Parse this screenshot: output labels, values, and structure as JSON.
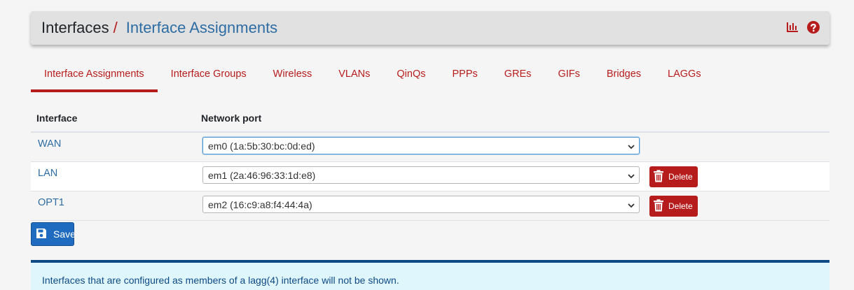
{
  "breadcrumb": {
    "root": "Interfaces",
    "separator": "/",
    "current": "Interface Assignments"
  },
  "header_icons": [
    "bar-chart-icon",
    "help-icon"
  ],
  "tabs": [
    {
      "label": "Interface Assignments",
      "active": true
    },
    {
      "label": "Interface Groups"
    },
    {
      "label": "Wireless"
    },
    {
      "label": "VLANs"
    },
    {
      "label": "QinQs"
    },
    {
      "label": "PPPs"
    },
    {
      "label": "GREs"
    },
    {
      "label": "GIFs"
    },
    {
      "label": "Bridges"
    },
    {
      "label": "LAGGs"
    }
  ],
  "table": {
    "headers": {
      "interface": "Interface",
      "port": "Network port"
    },
    "rows": [
      {
        "interface": "WAN",
        "port": "em0 (1a:5b:30:bc:0d:ed)",
        "has_delete": false
      },
      {
        "interface": "LAN",
        "port": "em1 (2a:46:96:33:1d:e8)",
        "delete": "Delete"
      },
      {
        "interface": "OPT1",
        "port": "em2 (16:c9:a8:f4:44:4a)",
        "delete": "Delete"
      }
    ]
  },
  "save_label": "Save",
  "info_message": "Interfaces that are configured as members of a lagg(4) interface will not be shown.",
  "colors": {
    "accent_red": "#b71c1c",
    "link_blue": "#2e6da4",
    "save_blue": "#1e6bbf",
    "info_bg": "#dff6fd",
    "info_border": "#0e4a84"
  }
}
